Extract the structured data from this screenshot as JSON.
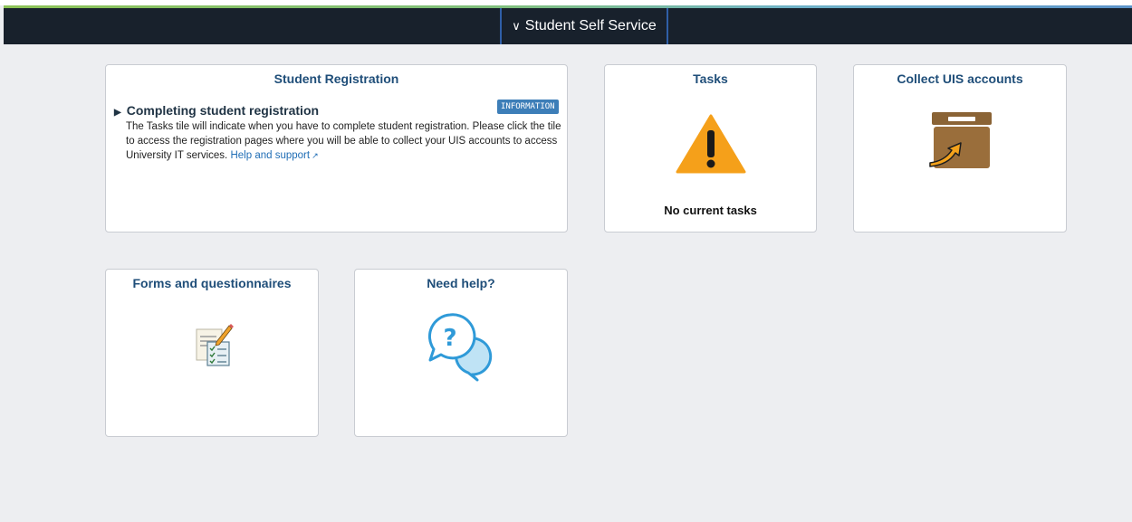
{
  "banner": {
    "title": "Student Self Service",
    "chevron": "chevron-down-icon"
  },
  "tiles": {
    "registration": {
      "title": "Student Registration",
      "heading": "Completing student registration",
      "badge": "INFORMATION",
      "body": "The Tasks tile will indicate when you have to complete student registration. Please click the tile to access the registration pages where you will be able to collect your UIS accounts to access University IT services.",
      "link": "Help and support",
      "link_icon": "external-link-icon"
    },
    "tasks": {
      "title": "Tasks",
      "icon": "warning-icon",
      "status": "No current tasks"
    },
    "collect": {
      "title": "Collect UIS accounts",
      "icon": "collect-box-icon"
    },
    "forms": {
      "title": "Forms and questionnaires",
      "icon": "form-checklist-icon"
    },
    "help": {
      "title": "Need help?",
      "icon": "help-chat-icon"
    }
  },
  "colors": {
    "banner_bg": "#18212c",
    "tile_title": "#1f4e79",
    "badge_bg": "#3d7eb8",
    "warning": "#f5a01a",
    "help_blue": "#2f9ad8"
  }
}
